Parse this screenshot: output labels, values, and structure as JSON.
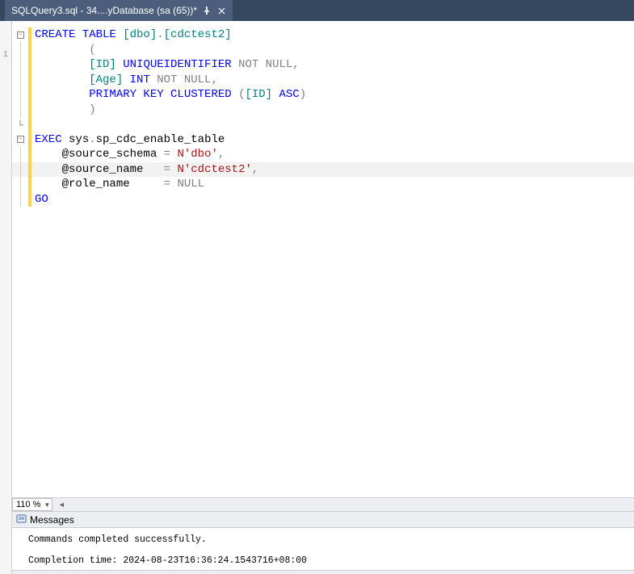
{
  "tab": {
    "title": "SQLQuery3.sql - 34....yDatabase (sa (65))*"
  },
  "gutter": {
    "marker": "1"
  },
  "code": {
    "lines": [
      {
        "fold": "-",
        "mod": true,
        "tokens": [
          {
            "cls": "kw-blue",
            "t": "CREATE TABLE "
          },
          {
            "cls": "kw-teal",
            "t": "[dbo]"
          },
          {
            "cls": "kw-gray",
            "t": "."
          },
          {
            "cls": "kw-teal",
            "t": "[cdctest2]"
          }
        ]
      },
      {
        "mod": true,
        "tokens": [
          {
            "cls": "txt",
            "t": "        "
          },
          {
            "cls": "kw-gray",
            "t": "("
          }
        ]
      },
      {
        "mod": true,
        "tokens": [
          {
            "cls": "txt",
            "t": "        "
          },
          {
            "cls": "kw-teal",
            "t": "[ID]"
          },
          {
            "cls": "txt",
            "t": " "
          },
          {
            "cls": "kw-blue",
            "t": "UNIQUEIDENTIFIER "
          },
          {
            "cls": "kw-gray",
            "t": "NOT NULL"
          },
          {
            "cls": "kw-gray",
            "t": ","
          }
        ]
      },
      {
        "mod": true,
        "tokens": [
          {
            "cls": "txt",
            "t": "        "
          },
          {
            "cls": "kw-teal",
            "t": "[Age]"
          },
          {
            "cls": "txt",
            "t": " "
          },
          {
            "cls": "kw-blue",
            "t": "INT "
          },
          {
            "cls": "kw-gray",
            "t": "NOT NULL"
          },
          {
            "cls": "kw-gray",
            "t": ","
          }
        ]
      },
      {
        "mod": true,
        "tokens": [
          {
            "cls": "txt",
            "t": "        "
          },
          {
            "cls": "kw-blue",
            "t": "PRIMARY KEY CLUSTERED "
          },
          {
            "cls": "kw-gray",
            "t": "("
          },
          {
            "cls": "kw-teal",
            "t": "[ID]"
          },
          {
            "cls": "txt",
            "t": " "
          },
          {
            "cls": "kw-blue",
            "t": "ASC"
          },
          {
            "cls": "kw-gray",
            "t": ")"
          }
        ]
      },
      {
        "mod": true,
        "tokens": [
          {
            "cls": "txt",
            "t": "        "
          },
          {
            "cls": "kw-gray",
            "t": ")"
          }
        ]
      },
      {
        "mod": true,
        "foldend": true,
        "tokens": []
      },
      {
        "fold": "-",
        "mod": true,
        "tokens": [
          {
            "cls": "kw-blue",
            "t": "EXEC "
          },
          {
            "cls": "txt",
            "t": "sys"
          },
          {
            "cls": "kw-gray",
            "t": "."
          },
          {
            "cls": "txt",
            "t": "sp_cdc_enable_table"
          }
        ]
      },
      {
        "mod": true,
        "tokens": [
          {
            "cls": "txt",
            "t": "    @source_schema "
          },
          {
            "cls": "kw-gray",
            "t": "= "
          },
          {
            "cls": "kw-red",
            "t": "N'dbo'"
          },
          {
            "cls": "kw-gray",
            "t": ","
          }
        ]
      },
      {
        "mod": true,
        "current": true,
        "tokens": [
          {
            "cls": "txt",
            "t": "    @source_name   "
          },
          {
            "cls": "kw-gray",
            "t": "= "
          },
          {
            "cls": "kw-red",
            "t": "N'cdctest2'"
          },
          {
            "cls": "kw-gray",
            "t": ","
          }
        ]
      },
      {
        "mod": true,
        "tokens": [
          {
            "cls": "txt",
            "t": "    @role_name     "
          },
          {
            "cls": "kw-gray",
            "t": "= NULL"
          }
        ]
      },
      {
        "mod": true,
        "tokens": [
          {
            "cls": "kw-blue",
            "t": "GO"
          }
        ]
      }
    ]
  },
  "zoom": {
    "value": "110 %"
  },
  "messages": {
    "tab_label": "Messages",
    "line1": "Commands completed successfully.",
    "line2": "Completion time: 2024-08-23T16:36:24.1543716+08:00"
  }
}
